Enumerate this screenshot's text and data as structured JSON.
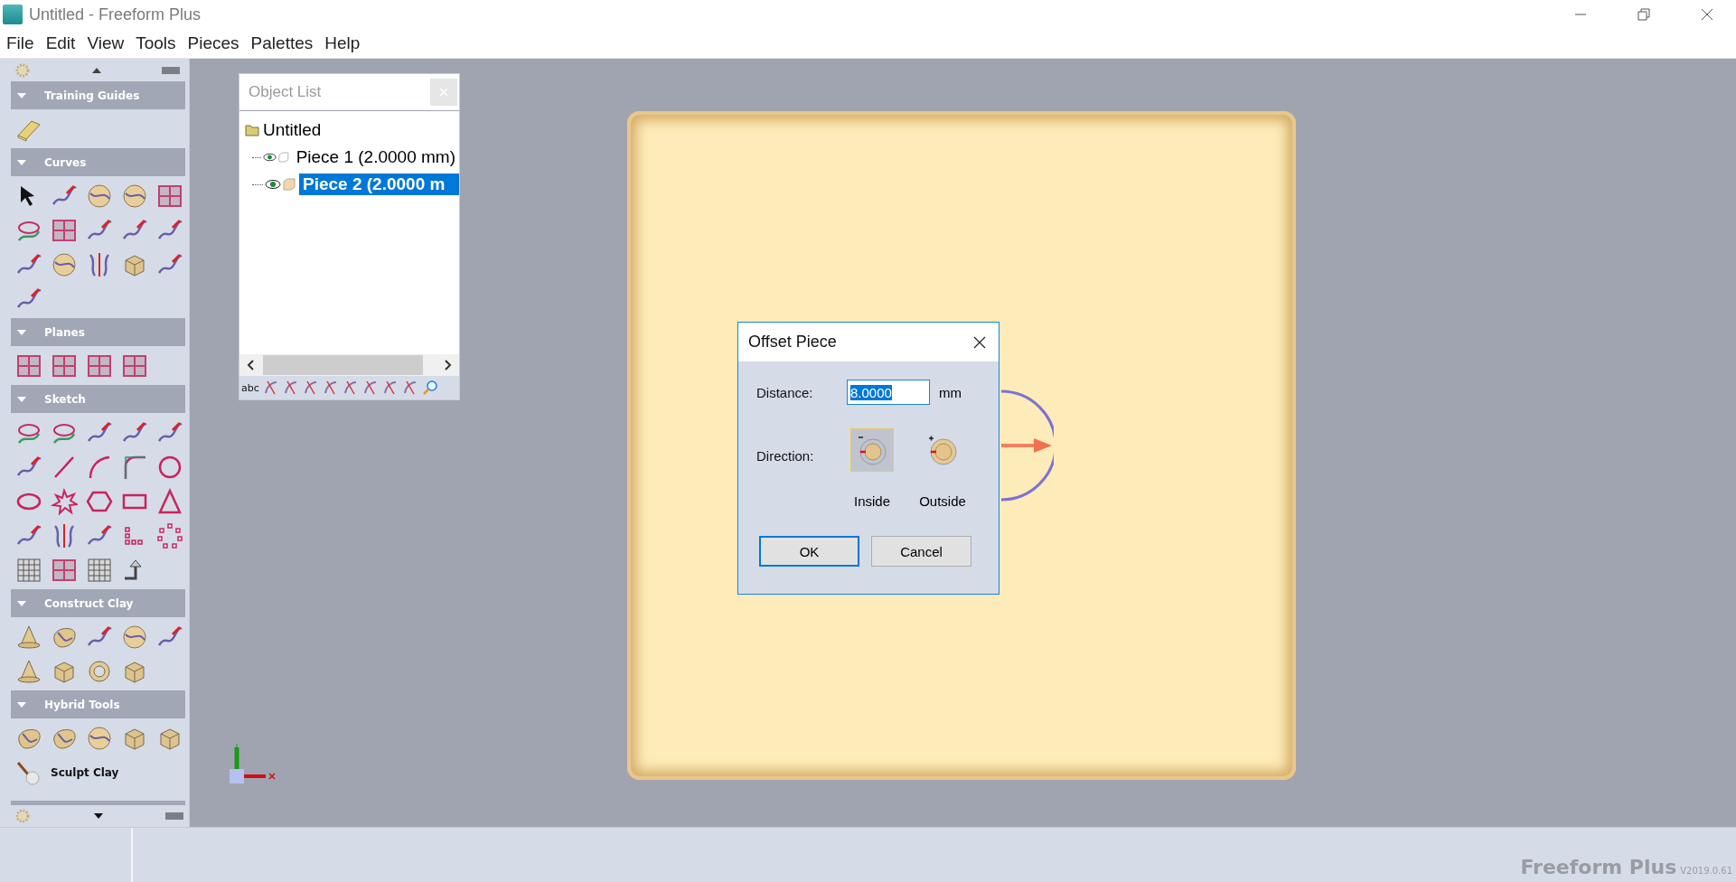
{
  "window": {
    "title": "Untitled - Freeform Plus"
  },
  "menu": [
    "File",
    "Edit",
    "View",
    "Tools",
    "Pieces",
    "Palettes",
    "Help"
  ],
  "palettes": [
    {
      "label": "Training Guides",
      "expanded": true
    },
    {
      "label": "Curves",
      "expanded": true
    },
    {
      "label": "Planes",
      "expanded": true
    },
    {
      "label": "Sketch",
      "expanded": true
    },
    {
      "label": "Construct Clay",
      "expanded": true
    },
    {
      "label": "Hybrid Tools",
      "expanded": true,
      "items": [
        {
          "label": "Sculpt Clay"
        }
      ]
    }
  ],
  "object_list": {
    "title": "Object List",
    "tree": [
      {
        "label": "Untitled",
        "children": [
          {
            "label": "Piece 1 (2.0000 mm)",
            "visible": true,
            "selected": false
          },
          {
            "label": "Piece 2 (2.0000 m",
            "visible": true,
            "selected": true
          }
        ]
      }
    ],
    "toolbar_label": "abc"
  },
  "dialog": {
    "title": "Offset Piece",
    "distance_label": "Distance:",
    "distance_value": "8.0000",
    "unit": "mm",
    "direction_label": "Direction:",
    "directions": [
      {
        "label": "Inside",
        "selected": true
      },
      {
        "label": "Outside",
        "selected": false
      }
    ],
    "buttons": [
      {
        "label": "OK",
        "default": true
      },
      {
        "label": "Cancel",
        "default": false
      }
    ]
  },
  "status_bar": {
    "brand": "Freeform Plus",
    "version": "V2019.0.61"
  }
}
